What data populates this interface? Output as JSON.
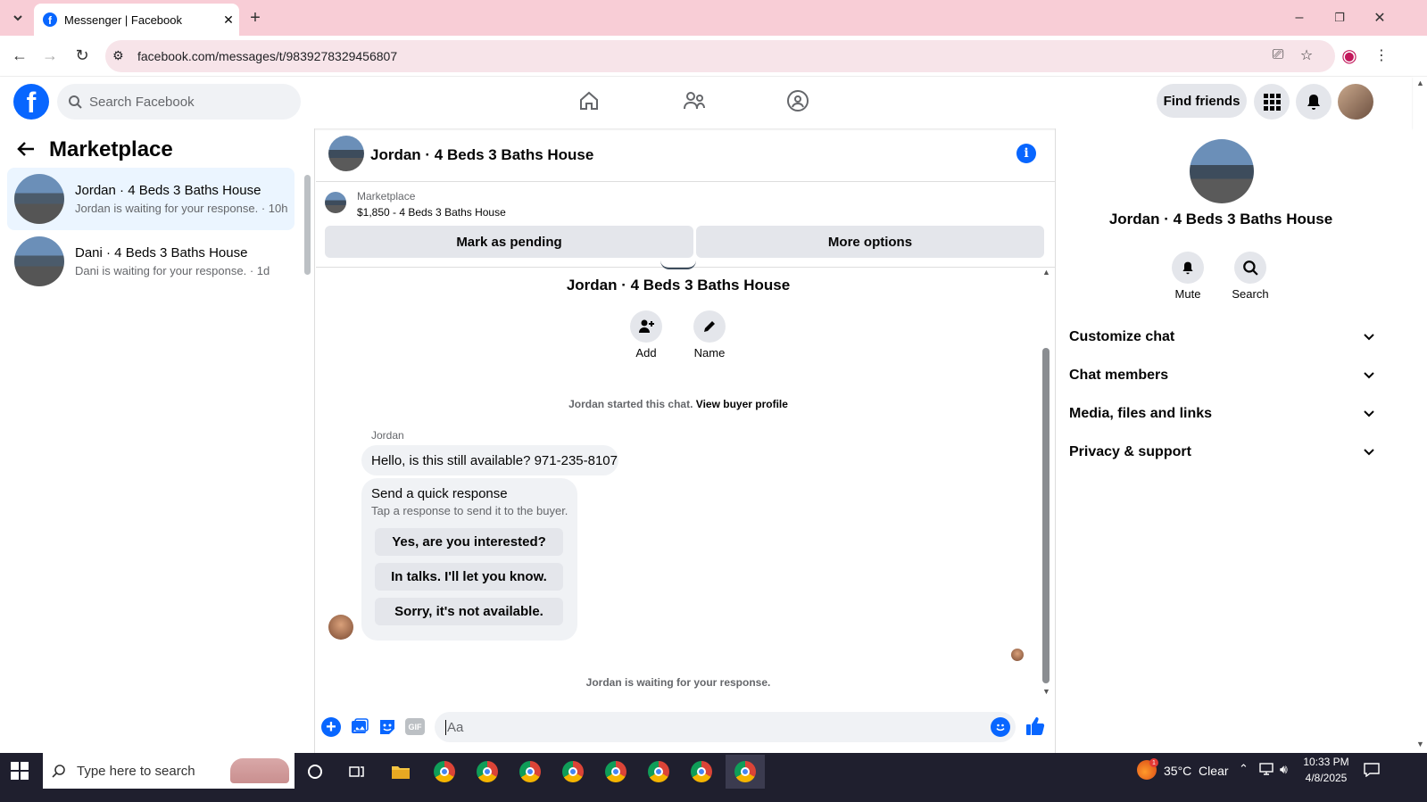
{
  "browser": {
    "tab_title": "Messenger | Facebook",
    "url": "facebook.com/messages/t/9839278329456807"
  },
  "header": {
    "search_placeholder": "Search Facebook",
    "find_friends": "Find friends"
  },
  "left_panel": {
    "title": "Marketplace",
    "conversations": [
      {
        "name": "Jordan · 4 Beds 3 Baths House",
        "preview": "Jordan is waiting for your response. · 10h",
        "selected": true
      },
      {
        "name": "Dani · 4 Beds 3 Baths House",
        "preview": "Dani is waiting for your response. · 1d",
        "selected": false
      }
    ]
  },
  "chat": {
    "title": "Jordan · 4 Beds 3 Baths House",
    "listing_source": "Marketplace",
    "listing_detail": "$1,850 - 4 Beds 3 Baths House",
    "mark_pending": "Mark as pending",
    "more_options": "More options",
    "group_name": "Jordan · 4 Beds 3 Baths House",
    "add_label": "Add",
    "name_label": "Name",
    "started_text": "Jordan started this chat.",
    "view_profile": "View buyer profile",
    "sender": "Jordan",
    "message": "Hello, is this still available? 971-235-8107",
    "quick_title": "Send a quick response",
    "quick_sub": "Tap a response to send it to the buyer.",
    "quick_replies": [
      "Yes, are you interested?",
      "In talks. I'll let you know.",
      "Sorry, it's not available."
    ],
    "waiting": "Jordan is waiting for your response.",
    "composer_placeholder": "Aa"
  },
  "right_panel": {
    "name": "Jordan · 4 Beds 3 Baths House",
    "mute": "Mute",
    "search": "Search",
    "sections": [
      "Customize chat",
      "Chat members",
      "Media, files and links",
      "Privacy & support"
    ]
  },
  "taskbar": {
    "search_placeholder": "Type here to search",
    "weather": "35°C  Clear",
    "time": "10:33 PM",
    "date": "4/8/2025",
    "weather_badge": "1"
  },
  "colors": {
    "fb_blue": "#0866ff",
    "tab_bar": "#f8cdd6",
    "bubble": "#f0f2f5"
  }
}
